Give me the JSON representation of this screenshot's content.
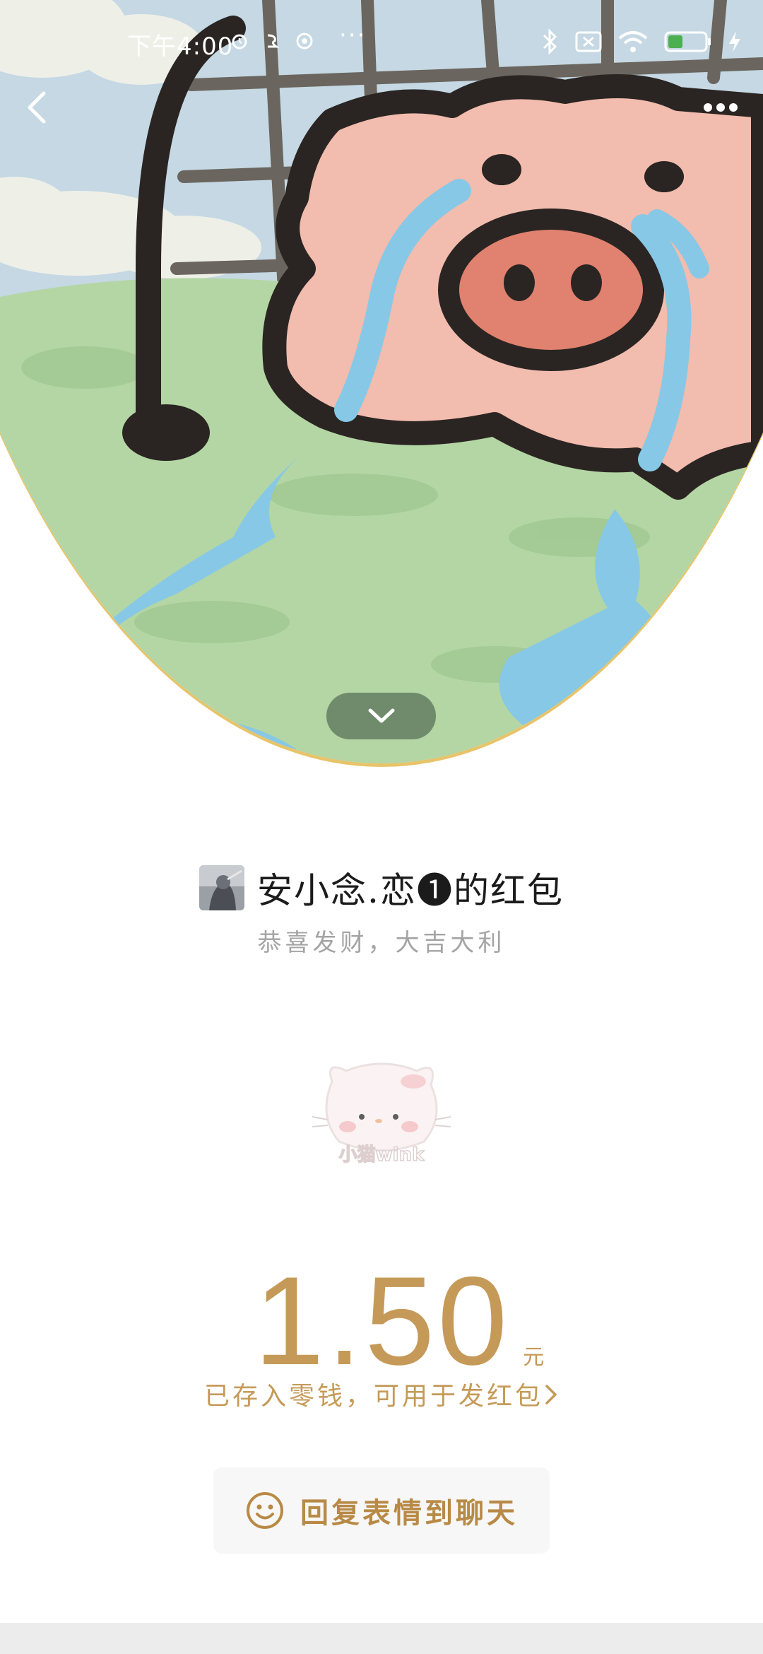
{
  "status_bar": {
    "time": "下午4:00",
    "more": "···",
    "battery_level": "36"
  },
  "icons": {
    "back": "chevron-left-icon",
    "more": "more-horizontal-icon",
    "collapse": "chevron-down-icon",
    "emoji": "smiley-icon",
    "wallet_chevron": "chevron-right-icon"
  },
  "envelope": {
    "sender_title": "安小念.恋❶的红包",
    "blessing": "恭喜发财，大吉大利",
    "sticker_text": "小猫wink"
  },
  "amount": {
    "value": "1.50",
    "unit": "元",
    "note": "已存入零钱，可用于发红包"
  },
  "reply_button": {
    "label": "回复表情到聊天"
  },
  "colors": {
    "accent_gold": "#c59a58",
    "reply_gold": "#b88a46",
    "cover_border": "#e7c46a"
  }
}
